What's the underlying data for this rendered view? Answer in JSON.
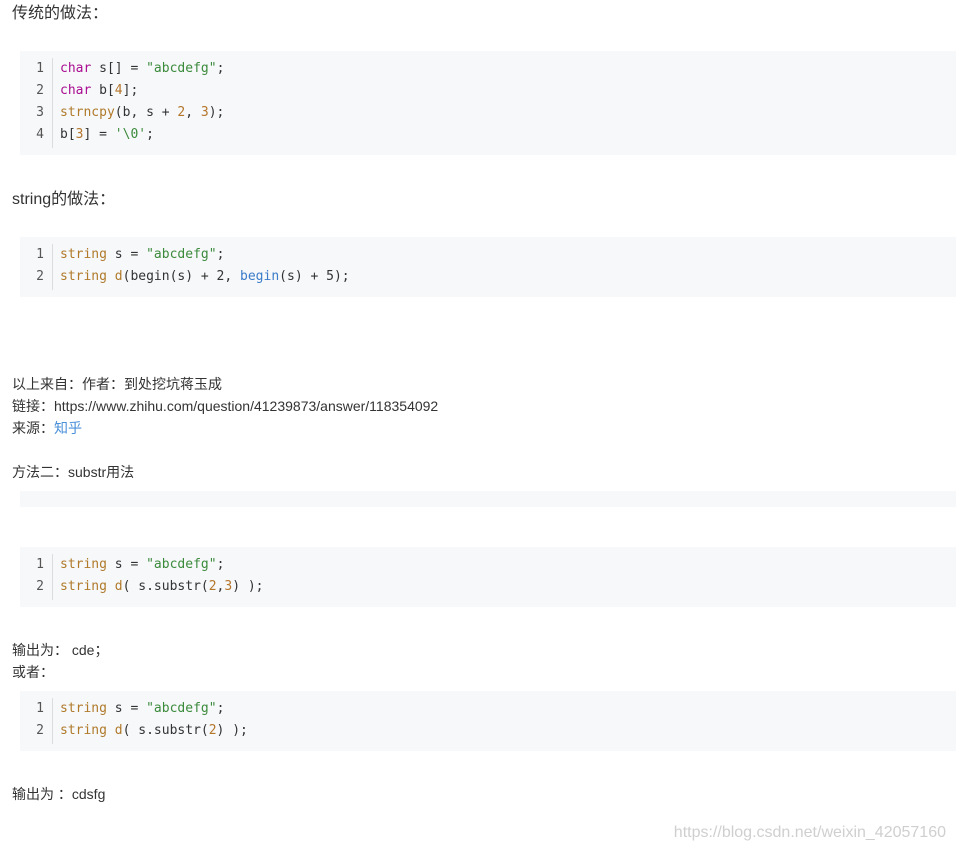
{
  "sections": {
    "traditional_title": "传统的做法：",
    "string_title": "string的做法："
  },
  "code_blocks": [
    {
      "lines": [
        {
          "n": "1",
          "tokens": [
            {
              "t": "char",
              "c": "kw"
            },
            {
              "t": " s[] = ",
              "c": "pl"
            },
            {
              "t": "\"abcdefg\"",
              "c": "st"
            },
            {
              "t": ";",
              "c": "pl"
            }
          ]
        },
        {
          "n": "2",
          "tokens": [
            {
              "t": "char",
              "c": "kw"
            },
            {
              "t": " b[",
              "c": "pl"
            },
            {
              "t": "4",
              "c": "nm"
            },
            {
              "t": "];",
              "c": "pl"
            }
          ]
        },
        {
          "n": "3",
          "tokens": [
            {
              "t": "strncpy",
              "c": "fn"
            },
            {
              "t": "(b, s + ",
              "c": "pl"
            },
            {
              "t": "2",
              "c": "nm"
            },
            {
              "t": ", ",
              "c": "pl"
            },
            {
              "t": "3",
              "c": "nm"
            },
            {
              "t": ");",
              "c": "pl"
            }
          ]
        },
        {
          "n": "4",
          "tokens": [
            {
              "t": "b[",
              "c": "pl"
            },
            {
              "t": "3",
              "c": "nm"
            },
            {
              "t": "] = ",
              "c": "pl"
            },
            {
              "t": "'\\0'",
              "c": "st"
            },
            {
              "t": ";",
              "c": "pl"
            }
          ]
        }
      ]
    },
    {
      "lines": [
        {
          "n": "1",
          "tokens": [
            {
              "t": "string",
              "c": "tp"
            },
            {
              "t": " s = ",
              "c": "pl"
            },
            {
              "t": "\"abcdefg\"",
              "c": "st"
            },
            {
              "t": ";",
              "c": "pl"
            }
          ]
        },
        {
          "n": "2",
          "tokens": [
            {
              "t": "string",
              "c": "tp"
            },
            {
              "t": " ",
              "c": "pl"
            },
            {
              "t": "d",
              "c": "fn"
            },
            {
              "t": "(begin(s) + 2, ",
              "c": "pl"
            },
            {
              "t": "begin",
              "c": "fn2"
            },
            {
              "t": "(s) + 5);",
              "c": "pl"
            }
          ]
        }
      ]
    },
    {
      "lines": [
        {
          "n": "1",
          "tokens": [
            {
              "t": "string",
              "c": "tp"
            },
            {
              "t": " s = ",
              "c": "pl"
            },
            {
              "t": "\"abcdefg\"",
              "c": "st"
            },
            {
              "t": ";",
              "c": "pl"
            }
          ]
        },
        {
          "n": "2",
          "tokens": [
            {
              "t": "string",
              "c": "tp"
            },
            {
              "t": " ",
              "c": "pl"
            },
            {
              "t": "d",
              "c": "fn"
            },
            {
              "t": "( s.substr(",
              "c": "pl"
            },
            {
              "t": "2",
              "c": "nm"
            },
            {
              "t": ",",
              "c": "pl"
            },
            {
              "t": "3",
              "c": "nm"
            },
            {
              "t": ") );",
              "c": "pl"
            }
          ]
        }
      ]
    },
    {
      "lines": [
        {
          "n": "1",
          "tokens": [
            {
              "t": "string",
              "c": "tp"
            },
            {
              "t": " s = ",
              "c": "pl"
            },
            {
              "t": "\"abcdefg\"",
              "c": "st"
            },
            {
              "t": ";",
              "c": "pl"
            }
          ]
        },
        {
          "n": "2",
          "tokens": [
            {
              "t": "string",
              "c": "tp"
            },
            {
              "t": " ",
              "c": "pl"
            },
            {
              "t": "d",
              "c": "fn"
            },
            {
              "t": "( s.substr(",
              "c": "pl"
            },
            {
              "t": "2",
              "c": "nm"
            },
            {
              "t": ") );",
              "c": "pl"
            }
          ]
        }
      ]
    }
  ],
  "source": {
    "from": "以上来自：作者：到处挖坑蒋玉成",
    "link_line": "链接：https://www.zhihu.com/question/41239873/answer/118354092",
    "source_label": "来源：",
    "source_link": "知乎"
  },
  "method2": {
    "title": "方法二：substr用法",
    "output1": "输出为： cde；",
    "or": "或者：",
    "output2": "输出为 ：cdsfg"
  },
  "watermark": "https://blog.csdn.net/weixin_42057160",
  "colors": {
    "code_bg": "#f6f8fa",
    "keyword": "#aa0d91",
    "type": "#b07a2a",
    "string": "#3c8a3c",
    "number": "#b5762b",
    "link": "#4a90d9"
  }
}
